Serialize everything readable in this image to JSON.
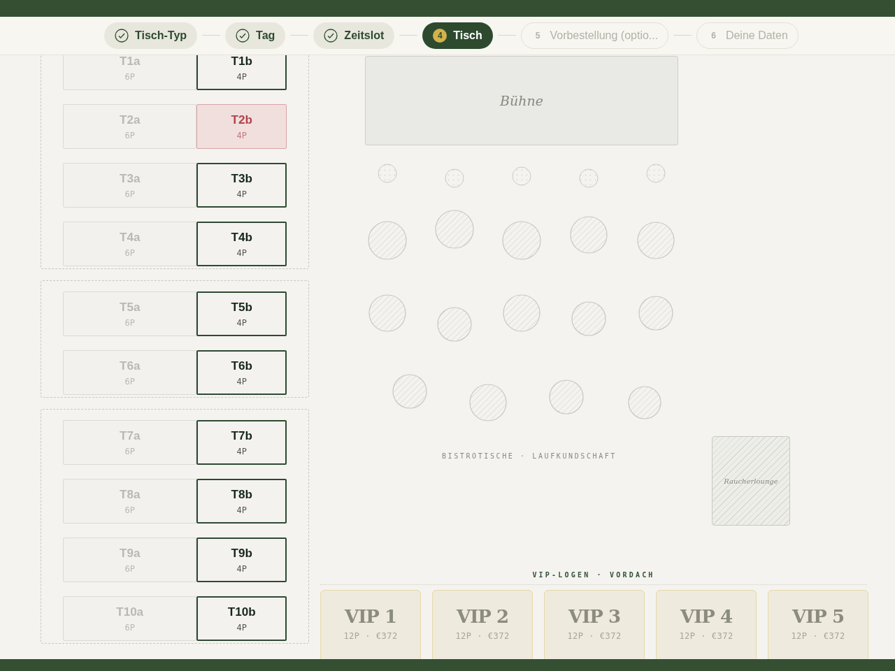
{
  "steps": [
    {
      "label": "Tisch-Typ",
      "completed": true,
      "selected": false
    },
    {
      "label": "Tag",
      "completed": true,
      "selected": false
    },
    {
      "label": "Zeitslot",
      "completed": true,
      "selected": false
    },
    {
      "label": "Tisch",
      "completed": false,
      "selected": true,
      "number": "4"
    },
    {
      "label": "Vorbestellung (optio...",
      "completed": false,
      "selected": false,
      "number": "5"
    },
    {
      "label": "Deine Daten",
      "completed": false,
      "selected": false,
      "number": "6"
    }
  ],
  "table_groups": [
    {
      "rows": [
        [
          {
            "name": "T1a",
            "capacity": "6P",
            "disabled": true,
            "reserved": false
          },
          {
            "name": "T1b",
            "capacity": "4P",
            "disabled": false,
            "reserved": false
          }
        ],
        [
          {
            "name": "T2a",
            "capacity": "6P",
            "disabled": true,
            "reserved": false
          },
          {
            "name": "T2b",
            "capacity": "4P",
            "disabled": false,
            "reserved": true
          }
        ],
        [
          {
            "name": "T3a",
            "capacity": "6P",
            "disabled": true,
            "reserved": false
          },
          {
            "name": "T3b",
            "capacity": "4P",
            "disabled": false,
            "reserved": false
          }
        ],
        [
          {
            "name": "T4a",
            "capacity": "6P",
            "disabled": true,
            "reserved": false
          },
          {
            "name": "T4b",
            "capacity": "4P",
            "disabled": false,
            "reserved": false
          }
        ]
      ]
    },
    {
      "rows": [
        [
          {
            "name": "T5a",
            "capacity": "6P",
            "disabled": true,
            "reserved": false
          },
          {
            "name": "T5b",
            "capacity": "4P",
            "disabled": false,
            "reserved": false
          }
        ],
        [
          {
            "name": "T6a",
            "capacity": "6P",
            "disabled": true,
            "reserved": false
          },
          {
            "name": "T6b",
            "capacity": "4P",
            "disabled": false,
            "reserved": false
          }
        ]
      ]
    },
    {
      "rows": [
        [
          {
            "name": "T7a",
            "capacity": "6P",
            "disabled": true,
            "reserved": false
          },
          {
            "name": "T7b",
            "capacity": "4P",
            "disabled": false,
            "reserved": false
          }
        ],
        [
          {
            "name": "T8a",
            "capacity": "6P",
            "disabled": true,
            "reserved": false
          },
          {
            "name": "T8b",
            "capacity": "4P",
            "disabled": false,
            "reserved": false
          }
        ],
        [
          {
            "name": "T9a",
            "capacity": "6P",
            "disabled": true,
            "reserved": false
          },
          {
            "name": "T9b",
            "capacity": "4P",
            "disabled": false,
            "reserved": false
          }
        ],
        [
          {
            "name": "T10a",
            "capacity": "6P",
            "disabled": true,
            "reserved": false
          },
          {
            "name": "T10b",
            "capacity": "4P",
            "disabled": false,
            "reserved": false
          }
        ]
      ]
    }
  ],
  "stage": {
    "label": "Bühne"
  },
  "bistro_label": "BISTROTISCHE · LAUFKUNDSCHAFT",
  "lounge": {
    "label": "Raucherlounge"
  },
  "vip": {
    "heading": "VIP-LOGEN · VORDACH",
    "boxes": [
      {
        "name": "VIP 1",
        "details": "12P · €372"
      },
      {
        "name": "VIP 2",
        "details": "12P · €372"
      },
      {
        "name": "VIP 3",
        "details": "12P · €372"
      },
      {
        "name": "VIP 4",
        "details": "12P · €372"
      },
      {
        "name": "VIP 5",
        "details": "12P · €372"
      }
    ]
  }
}
